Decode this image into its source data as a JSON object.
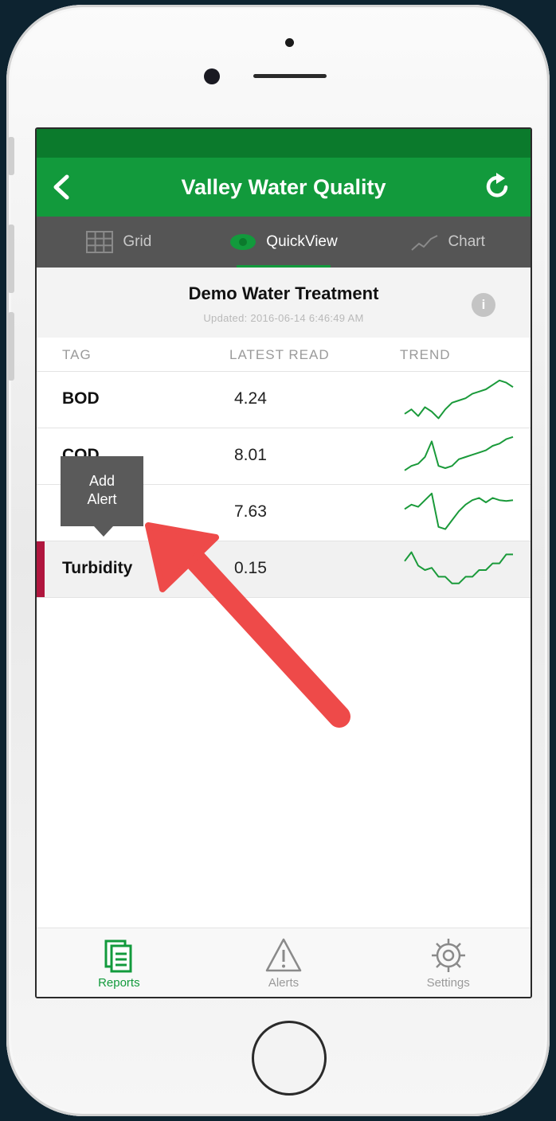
{
  "nav": {
    "title": "Valley Water Quality",
    "back_icon": "chevron-left-icon",
    "refresh_icon": "refresh-icon"
  },
  "tabs": [
    {
      "label": "Grid",
      "icon": "grid-icon",
      "active": false
    },
    {
      "label": "QuickView",
      "icon": "eye-icon",
      "active": true
    },
    {
      "label": "Chart",
      "icon": "line-chart-icon",
      "active": false
    }
  ],
  "header": {
    "title": "Demo Water Treatment",
    "updated": "Updated: 2016-06-14 6:46:49 AM"
  },
  "columns": {
    "tag": "TAG",
    "latest": "LATEST READ",
    "trend": "TREND"
  },
  "rows": [
    {
      "tag": "BOD",
      "value": "4.24",
      "trend": [
        0.2,
        0.3,
        0.15,
        0.35,
        0.25,
        0.1,
        0.3,
        0.45,
        0.5,
        0.55,
        0.65,
        0.7,
        0.75,
        0.85,
        0.95,
        0.9,
        0.8
      ]
    },
    {
      "tag": "COD",
      "value": "8.01",
      "trend": [
        0.2,
        0.3,
        0.35,
        0.5,
        0.85,
        0.3,
        0.25,
        0.3,
        0.45,
        0.5,
        0.55,
        0.6,
        0.65,
        0.75,
        0.8,
        0.9,
        0.95
      ]
    },
    {
      "tag": "",
      "value": "7.63",
      "trend": [
        0.6,
        0.7,
        0.65,
        0.8,
        0.95,
        0.2,
        0.15,
        0.35,
        0.55,
        0.7,
        0.8,
        0.85,
        0.75,
        0.85,
        0.8,
        0.78,
        0.8
      ]
    },
    {
      "tag": "Turbidity",
      "value": "0.15",
      "trend": [
        0.7,
        0.9,
        0.6,
        0.5,
        0.55,
        0.35,
        0.35,
        0.2,
        0.2,
        0.35,
        0.35,
        0.5,
        0.5,
        0.65,
        0.65,
        0.85,
        0.85
      ]
    }
  ],
  "selected_row_color": "#b0163e",
  "tooltip": {
    "line1": "Add",
    "line2": "Alert"
  },
  "tabbar": [
    {
      "label": "Reports",
      "icon": "reports-icon",
      "active": true
    },
    {
      "label": "Alerts",
      "icon": "alert-triangle-icon",
      "active": false
    },
    {
      "label": "Settings",
      "icon": "gear-icon",
      "active": false
    }
  ],
  "colors": {
    "brand": "#129a3c",
    "status": "#0b7a2c",
    "trend": "#1a9a3a",
    "arrow": "#ee4a49"
  }
}
